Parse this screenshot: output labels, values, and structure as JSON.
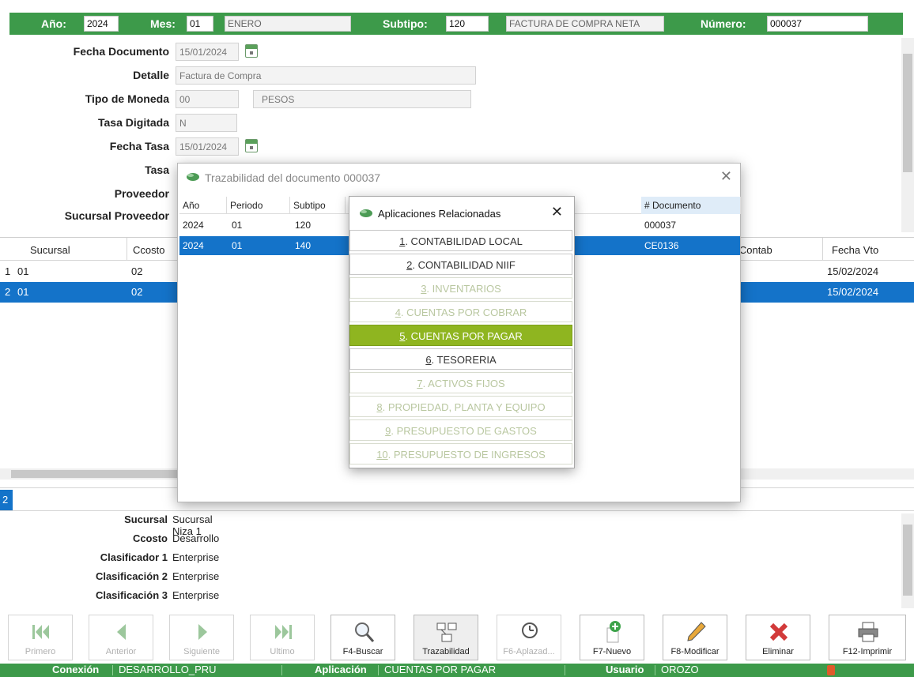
{
  "header": {
    "anio_label": "Año:",
    "anio": "2024",
    "mes_label": "Mes:",
    "mes": "01",
    "mes_nombre": "ENERO",
    "subtipo_label": "Subtipo:",
    "subtipo": "120",
    "subtipo_nombre": "FACTURA DE COMPRA NETA",
    "numero_label": "Número:",
    "numero": "000037"
  },
  "form": {
    "fecha_documento_label": "Fecha Documento",
    "fecha_documento": "15/01/2024",
    "detalle_label": "Detalle",
    "detalle": "Factura de Compra",
    "tipo_moneda_label": "Tipo de Moneda",
    "tipo_moneda_codigo": "00",
    "tipo_moneda_nombre": "PESOS",
    "tasa_digitada_label": "Tasa Digitada",
    "tasa_digitada": "N",
    "fecha_tasa_label": "Fecha Tasa",
    "fecha_tasa": "15/01/2024",
    "tasa_label": "Tasa",
    "proveedor_label": "Proveedor",
    "sucursal_proveedor_label": "Sucursal Proveedor"
  },
  "grid": {
    "columns": [
      "Sucursal",
      "Ccosto",
      "d Contab",
      "Fecha Vto"
    ],
    "rows": [
      {
        "num": "1",
        "sucursal": "01",
        "ccosto": "02",
        "fecha_vto": "15/02/2024"
      },
      {
        "num": "2",
        "sucursal": "01",
        "ccosto": "02",
        "fecha_vto": "15/02/2024"
      }
    ],
    "footer_count": "2"
  },
  "detail": {
    "sucursal_label": "Sucursal",
    "sucursal": "Sucursal Niza 1",
    "ccosto_label": "Ccosto",
    "ccosto": "Desarrollo",
    "clasificador1_label": "Clasificador 1",
    "clasificador1": "Enterprise",
    "clasificacion2_label": "Clasificación 2",
    "clasificacion2": "Enterprise",
    "clasificacion3_label": "Clasificación 3",
    "clasificacion3": "Enterprise"
  },
  "toolbar": {
    "primero": "Primero",
    "anterior": "Anterior",
    "siguiente": "Siguiente",
    "ultimo": "Ultimo",
    "buscar": "F4-Buscar",
    "trazabilidad": "Trazabilidad",
    "aplazad": "F6-Aplazad...",
    "nuevo": "F7-Nuevo",
    "modificar": "F8-Modificar",
    "eliminar": "Eliminar",
    "imprimir": "F12-Imprimir"
  },
  "status": {
    "conexion_label": "Conexión",
    "conexion": "DESARROLLO_PRU",
    "aplicacion_label": "Aplicación",
    "aplicacion": "CUENTAS POR PAGAR",
    "usuario_label": "Usuario",
    "usuario": "OROZO"
  },
  "trazabilidad": {
    "title": "Trazabilidad del documento 000037",
    "columns": [
      "Año",
      "Periodo",
      "Subtipo",
      "# Documento"
    ],
    "rows": [
      {
        "anio": "2024",
        "periodo": "01",
        "subtipo": "120",
        "documento": "000037"
      },
      {
        "anio": "2024",
        "periodo": "01",
        "subtipo": "140",
        "documento": "CE0136"
      }
    ]
  },
  "aplicaciones": {
    "title": "Aplicaciones Relacionadas",
    "items": [
      {
        "n": "1",
        "label": "CONTABILIDAD LOCAL",
        "state": "enabled"
      },
      {
        "n": "2",
        "label": "CONTABILIDAD NIIF",
        "state": "enabled"
      },
      {
        "n": "3",
        "label": "INVENTARIOS",
        "state": "disabled"
      },
      {
        "n": "4",
        "label": "CUENTAS POR COBRAR",
        "state": "disabled"
      },
      {
        "n": "5",
        "label": "CUENTAS POR PAGAR",
        "state": "active"
      },
      {
        "n": "6",
        "label": "TESORERIA",
        "state": "enabled"
      },
      {
        "n": "7",
        "label": "ACTIVOS FIJOS",
        "state": "disabled"
      },
      {
        "n": "8",
        "label": "PROPIEDAD, PLANTA Y EQUIPO",
        "state": "disabled"
      },
      {
        "n": "9",
        "label": "PRESUPUESTO DE GASTOS",
        "state": "disabled"
      },
      {
        "n": "10",
        "label": "PRESUPUESTO DE INGRESOS",
        "state": "disabled"
      }
    ]
  },
  "colors": {
    "header_green": "#3d9a4a",
    "selection_blue": "#1473c9",
    "active_item": "#8fb520"
  }
}
